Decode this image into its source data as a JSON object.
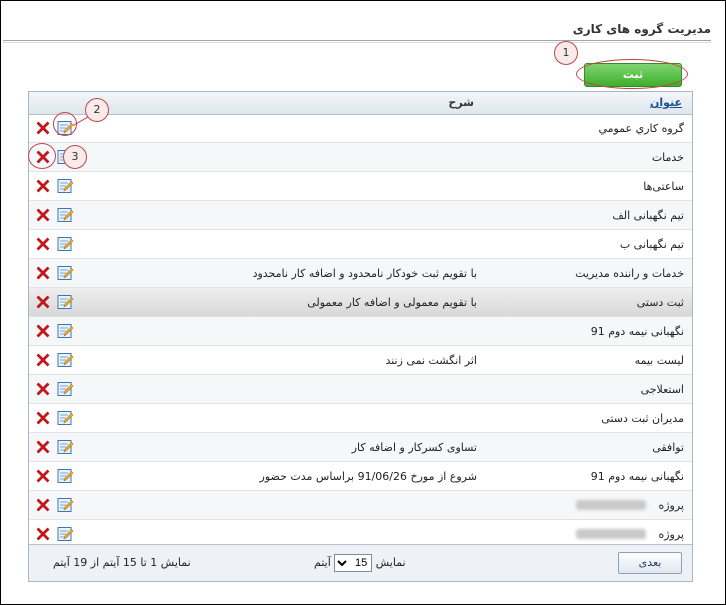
{
  "page": {
    "title": "مدیریت گروه های کاری"
  },
  "toolbar": {
    "save_label": "ثبت"
  },
  "callouts": [
    "1",
    "2",
    "3"
  ],
  "grid": {
    "columns": {
      "title": "عنوان",
      "description": "شرح"
    },
    "rows": [
      {
        "title": "گروه كاري عمومي",
        "description": ""
      },
      {
        "title": "خدمات",
        "description": ""
      },
      {
        "title": "ساعتی‌ها",
        "description": ""
      },
      {
        "title": "تیم نگهبانی الف",
        "description": ""
      },
      {
        "title": "تیم نگهبانی ب",
        "description": ""
      },
      {
        "title": "خدمات و راننده مدیریت",
        "description": "با تقویم ثبت خودکار نامحدود و اضافه کار نامحدود"
      },
      {
        "title": "ثبت دستی",
        "description": "با تقویم معمولی و اضافه کار معمولی"
      },
      {
        "title": "نگهبانی نیمه دوم 91",
        "description": ""
      },
      {
        "title": "لیست بیمه",
        "description": "اثر انگشت نمی زنند"
      },
      {
        "title": "استعلاجی",
        "description": ""
      },
      {
        "title": "مدیران ثبت دستی",
        "description": ""
      },
      {
        "title": "توافقی",
        "description": "تساوی کسرکار و اضافه کار"
      },
      {
        "title": "نگهبانی نیمه دوم 91",
        "description": "شروع از مورخ 91/06/26 براساس مدت حضور"
      },
      {
        "title": "پروژه",
        "description": ""
      },
      {
        "title": "پروژه",
        "description": ""
      }
    ]
  },
  "footer": {
    "next_label": "بعدی",
    "show_label": "نمایش",
    "page_size": "15",
    "items_label": "آیتم",
    "page_info": "نمایش 1 تا 15 آیتم از 19 آیتم"
  },
  "icons": {
    "delete": "delete-x-icon",
    "edit": "edit-pencil-icon"
  },
  "colors": {
    "save_button": "#3eae2e",
    "delete_icon": "#d4161b",
    "header_link": "#1d4f8f",
    "callout_border": "#c4434a"
  }
}
